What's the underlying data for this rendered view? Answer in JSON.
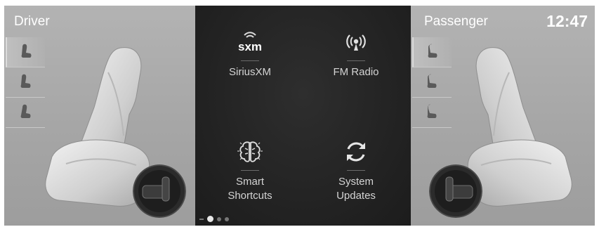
{
  "driver": {
    "title": "Driver"
  },
  "passenger": {
    "title": "Passenger"
  },
  "status": {
    "clock": "12:47"
  },
  "apps": [
    {
      "label": "SiriusXM",
      "logo": "sxm",
      "icon": "siriusxm-icon"
    },
    {
      "label": "FM Radio",
      "icon": "radio-broadcast-icon"
    },
    {
      "label_line1": "Smart",
      "label_line2": "Shortcuts",
      "icon": "brain-icon"
    },
    {
      "label_line1": "System",
      "label_line2": "Updates",
      "icon": "refresh-icon"
    }
  ],
  "page_indicator": {
    "current": 1,
    "total": 3
  }
}
